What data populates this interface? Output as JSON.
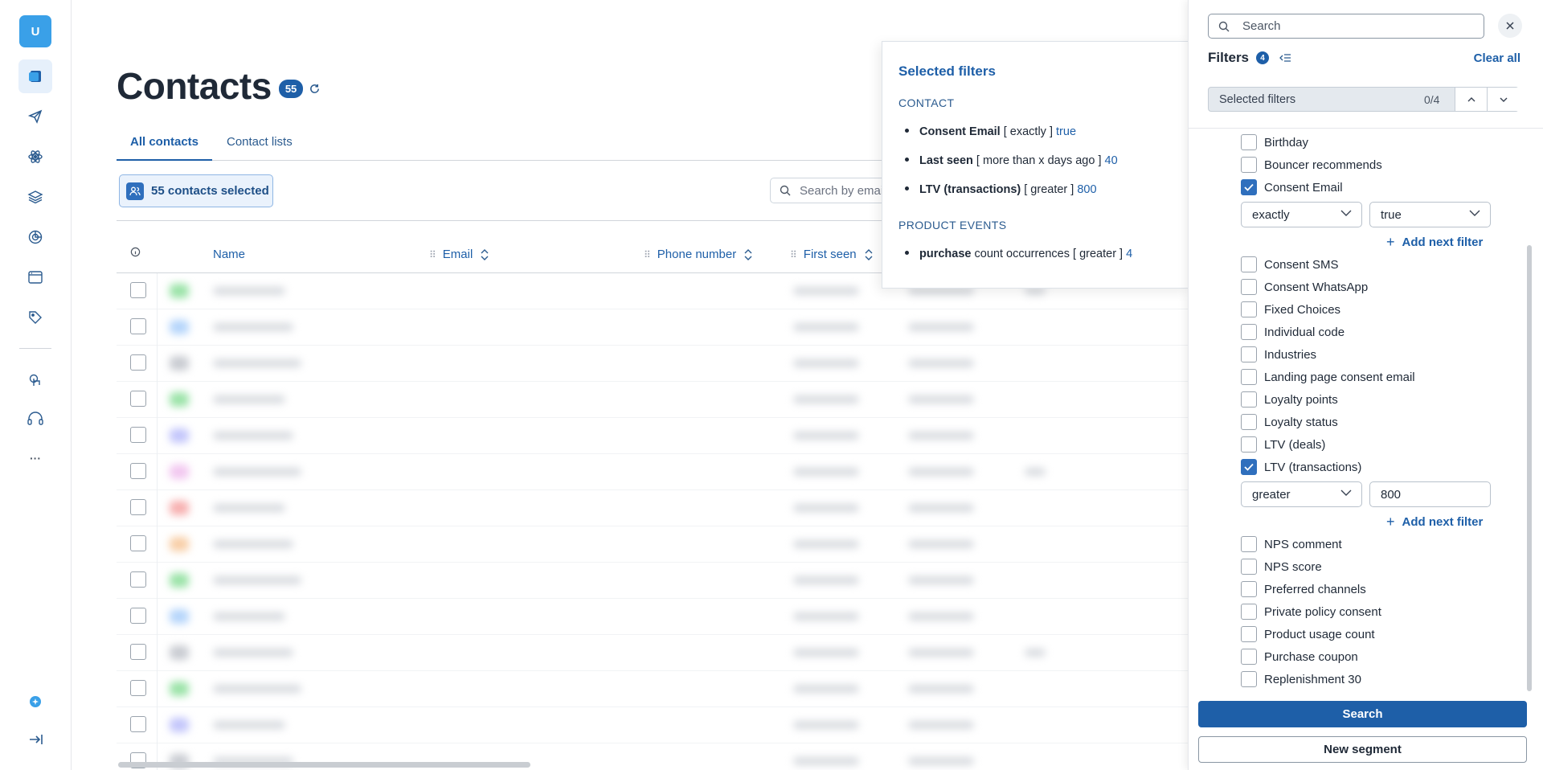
{
  "sidebar": {
    "avatar_initial": "U",
    "items": [
      {
        "icon": "contacts-icon",
        "active": true
      },
      {
        "icon": "send-icon"
      },
      {
        "icon": "atom-icon"
      },
      {
        "icon": "layers-icon"
      },
      {
        "icon": "segments-icon"
      },
      {
        "icon": "browser-icon"
      },
      {
        "icon": "tag-icon"
      },
      {
        "icon": "touch-icon"
      },
      {
        "icon": "support-icon"
      },
      {
        "icon": "more-icon"
      }
    ],
    "more_label": "···"
  },
  "page": {
    "title": "Contacts",
    "count": "55"
  },
  "tabs": [
    {
      "label": "All contacts",
      "active": true
    },
    {
      "label": "Contact lists"
    }
  ],
  "toolbar": {
    "selected_label": "55 contacts selected",
    "search_placeholder": "Search by email"
  },
  "table": {
    "columns": [
      "Name",
      "Email",
      "Phone number",
      "First seen"
    ],
    "row_count": 14
  },
  "popover": {
    "title": "Selected filters",
    "sections": [
      {
        "heading": "CONTACT",
        "items": [
          {
            "field": "Consent Email",
            "operator": " [ exactly ] ",
            "value": "true"
          },
          {
            "field": "Last seen",
            "operator": " [ more than x days ago ] ",
            "value": "40"
          },
          {
            "field": "LTV (transactions)",
            "operator": " [ greater ] ",
            "value": "800"
          }
        ]
      },
      {
        "heading": "PRODUCT EVENTS",
        "items": [
          {
            "field": "purchase",
            "operator": " count occurrences [ greater ] ",
            "value": "4"
          }
        ]
      }
    ]
  },
  "panel": {
    "search_placeholder": "Search",
    "filters_title": "Filters",
    "filters_count": "4",
    "clear_all": "Clear all",
    "selected_filters_label": "Selected filters",
    "selected_filters_count": "0/4",
    "add_next_filter": "Add next filter",
    "items": [
      {
        "label": "Birthday",
        "checked": false
      },
      {
        "label": "Bouncer recommends",
        "checked": false
      },
      {
        "label": "Consent Email",
        "checked": true,
        "operator": "exactly",
        "value": "true"
      },
      {
        "label": "Consent SMS",
        "checked": false
      },
      {
        "label": "Consent WhatsApp",
        "checked": false
      },
      {
        "label": "Fixed Choices",
        "checked": false
      },
      {
        "label": "Individual code",
        "checked": false
      },
      {
        "label": "Industries",
        "checked": false
      },
      {
        "label": "Landing page consent email",
        "checked": false
      },
      {
        "label": "Loyalty points",
        "checked": false
      },
      {
        "label": "Loyalty status",
        "checked": false
      },
      {
        "label": "LTV (deals)",
        "checked": false
      },
      {
        "label": "LTV (transactions)",
        "checked": true,
        "operator": "greater",
        "value": "800"
      },
      {
        "label": "NPS comment",
        "checked": false
      },
      {
        "label": "NPS score",
        "checked": false
      },
      {
        "label": "Preferred channels",
        "checked": false
      },
      {
        "label": "Private policy consent",
        "checked": false
      },
      {
        "label": "Product usage count",
        "checked": false
      },
      {
        "label": "Purchase coupon",
        "checked": false
      },
      {
        "label": "Replenishment 30",
        "checked": false
      }
    ],
    "search_button": "Search",
    "new_segment_button": "New segment"
  },
  "colors": {
    "accent": "#1e5fa8",
    "avatar": "#3aa0e8",
    "checkbox_checked": "#2f6fbd"
  }
}
